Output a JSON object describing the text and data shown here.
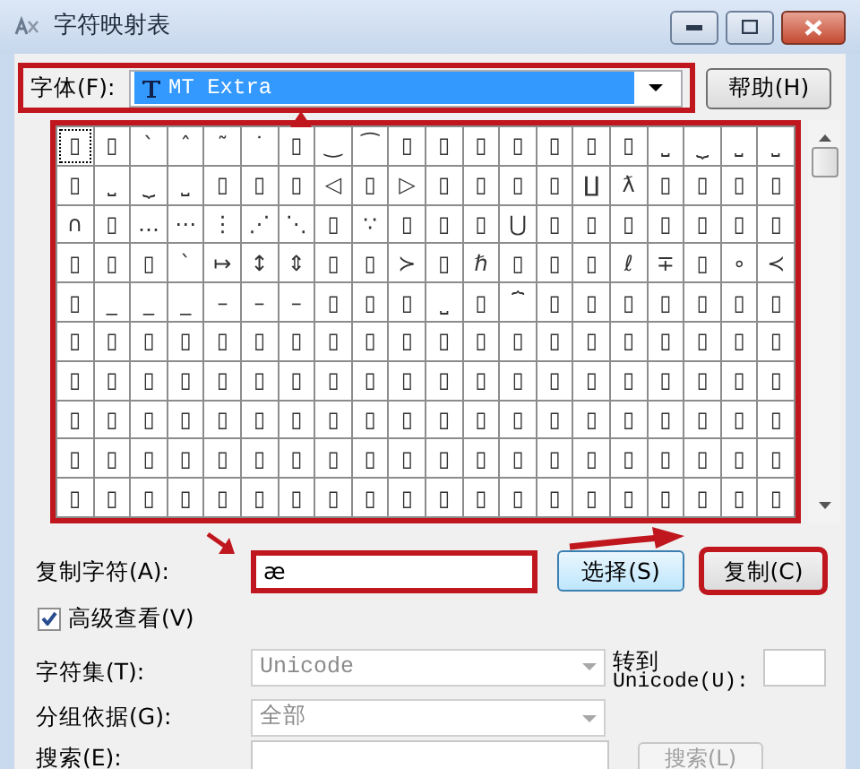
{
  "window": {
    "title": "字符映射表"
  },
  "font": {
    "label": "字体(F):",
    "value": "MT Extra",
    "highlighted": true
  },
  "help_button": {
    "label": "帮助(H)"
  },
  "character_grid": {
    "highlighted": true,
    "rows": [
      [
        {
          "char": "▯",
          "selected": true
        },
        {
          "char": "▯",
          "selected": false
        },
        {
          "char": "`",
          "selected": false
        },
        {
          "char": "ˆ",
          "selected": false
        },
        {
          "char": "˜",
          "selected": false
        },
        {
          "char": "˙",
          "selected": false
        },
        {
          "char": "▯",
          "selected": false
        },
        {
          "char": "‿",
          "selected": false
        },
        {
          "char": "⁀",
          "selected": false
        },
        {
          "char": "▯",
          "selected": false
        },
        {
          "char": "▯",
          "selected": false
        },
        {
          "char": "▯",
          "selected": false
        },
        {
          "char": "▯",
          "selected": false
        },
        {
          "char": "▯",
          "selected": false
        },
        {
          "char": "▯",
          "selected": false
        },
        {
          "char": "▯",
          "selected": false
        },
        {
          "char": "⎵",
          "selected": false
        },
        {
          "char": "⏟",
          "selected": false
        },
        {
          "char": "⎵",
          "selected": false
        },
        {
          "char": "⎵",
          "selected": false
        }
      ],
      [
        {
          "char": "▯",
          "selected": false
        },
        {
          "char": "⎵",
          "selected": false
        },
        {
          "char": "⏟",
          "selected": false
        },
        {
          "char": "⎵",
          "selected": false
        },
        {
          "char": "▯",
          "selected": false
        },
        {
          "char": "▯",
          "selected": false
        },
        {
          "char": "▯",
          "selected": false
        },
        {
          "char": "◁",
          "selected": false
        },
        {
          "char": "▯",
          "selected": false
        },
        {
          "char": "▷",
          "selected": false
        },
        {
          "char": "▯",
          "selected": false
        },
        {
          "char": "▯",
          "selected": false
        },
        {
          "char": "▯",
          "selected": false
        },
        {
          "char": "▯",
          "selected": false
        },
        {
          "char": "∐",
          "selected": false
        },
        {
          "char": "ƛ",
          "selected": false
        },
        {
          "char": "▯",
          "selected": false
        },
        {
          "char": "▯",
          "selected": false
        },
        {
          "char": "▯",
          "selected": false
        },
        {
          "char": "▯",
          "selected": false
        }
      ],
      [
        {
          "char": "∩",
          "selected": false
        },
        {
          "char": "▯",
          "selected": false
        },
        {
          "char": "…",
          "selected": false
        },
        {
          "char": "⋯",
          "selected": false
        },
        {
          "char": "⋮",
          "selected": false
        },
        {
          "char": "⋰",
          "selected": false
        },
        {
          "char": "⋱",
          "selected": false
        },
        {
          "char": "▯",
          "selected": false
        },
        {
          "char": "∵",
          "selected": false
        },
        {
          "char": "▯",
          "selected": false
        },
        {
          "char": "▯",
          "selected": false
        },
        {
          "char": "▯",
          "selected": false
        },
        {
          "char": "⋃",
          "selected": false
        },
        {
          "char": "▯",
          "selected": false
        },
        {
          "char": "▯",
          "selected": false
        },
        {
          "char": "▯",
          "selected": false
        },
        {
          "char": "▯",
          "selected": false
        },
        {
          "char": "▯",
          "selected": false
        },
        {
          "char": "▯",
          "selected": false
        },
        {
          "char": "▯",
          "selected": false
        }
      ],
      [
        {
          "char": "▯",
          "selected": false
        },
        {
          "char": "▯",
          "selected": false
        },
        {
          "char": "▯",
          "selected": false
        },
        {
          "char": "ˋ",
          "selected": false
        },
        {
          "char": "↦",
          "selected": false
        },
        {
          "char": "↕",
          "selected": false
        },
        {
          "char": "⇕",
          "selected": false
        },
        {
          "char": "▯",
          "selected": false
        },
        {
          "char": "▯",
          "selected": false
        },
        {
          "char": "≻",
          "selected": false
        },
        {
          "char": "▯",
          "selected": false
        },
        {
          "char": "ℏ",
          "selected": false
        },
        {
          "char": "▯",
          "selected": false
        },
        {
          "char": "▯",
          "selected": false
        },
        {
          "char": "▯",
          "selected": false
        },
        {
          "char": "ℓ",
          "selected": false
        },
        {
          "char": "∓",
          "selected": false
        },
        {
          "char": "▯",
          "selected": false
        },
        {
          "char": "∘",
          "selected": false
        },
        {
          "char": "≺",
          "selected": false
        }
      ],
      [
        {
          "char": "▯",
          "selected": false
        },
        {
          "char": "_",
          "selected": false
        },
        {
          "char": "_",
          "selected": false
        },
        {
          "char": "_",
          "selected": false
        },
        {
          "char": "–",
          "selected": false
        },
        {
          "char": "–",
          "selected": false
        },
        {
          "char": "–",
          "selected": false
        },
        {
          "char": "▯",
          "selected": false
        },
        {
          "char": "▯",
          "selected": false
        },
        {
          "char": "▯",
          "selected": false
        },
        {
          "char": "⎵",
          "selected": false
        },
        {
          "char": "▯",
          "selected": false
        },
        {
          "char": "⏞",
          "selected": false
        },
        {
          "char": "▯",
          "selected": false
        },
        {
          "char": "▯",
          "selected": false
        },
        {
          "char": "▯",
          "selected": false
        },
        {
          "char": "▯",
          "selected": false
        },
        {
          "char": "▯",
          "selected": false
        },
        {
          "char": "▯",
          "selected": false
        },
        {
          "char": "▯",
          "selected": false
        }
      ],
      [
        {
          "char": "▯",
          "selected": false
        },
        {
          "char": "▯",
          "selected": false
        },
        {
          "char": "▯",
          "selected": false
        },
        {
          "char": "▯",
          "selected": false
        },
        {
          "char": "▯",
          "selected": false
        },
        {
          "char": "▯",
          "selected": false
        },
        {
          "char": "▯",
          "selected": false
        },
        {
          "char": "▯",
          "selected": false
        },
        {
          "char": "▯",
          "selected": false
        },
        {
          "char": "▯",
          "selected": false
        },
        {
          "char": "▯",
          "selected": false
        },
        {
          "char": "▯",
          "selected": false
        },
        {
          "char": "▯",
          "selected": false
        },
        {
          "char": "▯",
          "selected": false
        },
        {
          "char": "▯",
          "selected": false
        },
        {
          "char": "▯",
          "selected": false
        },
        {
          "char": "▯",
          "selected": false
        },
        {
          "char": "▯",
          "selected": false
        },
        {
          "char": "▯",
          "selected": false
        },
        {
          "char": "▯",
          "selected": false
        }
      ],
      [
        {
          "char": "▯",
          "selected": false
        },
        {
          "char": "▯",
          "selected": false
        },
        {
          "char": "▯",
          "selected": false
        },
        {
          "char": "▯",
          "selected": false
        },
        {
          "char": "▯",
          "selected": false
        },
        {
          "char": "▯",
          "selected": false
        },
        {
          "char": "▯",
          "selected": false
        },
        {
          "char": "▯",
          "selected": false
        },
        {
          "char": "▯",
          "selected": false
        },
        {
          "char": "▯",
          "selected": false
        },
        {
          "char": "▯",
          "selected": false
        },
        {
          "char": "▯",
          "selected": false
        },
        {
          "char": "▯",
          "selected": false
        },
        {
          "char": "▯",
          "selected": false
        },
        {
          "char": "▯",
          "selected": false
        },
        {
          "char": "▯",
          "selected": false
        },
        {
          "char": "▯",
          "selected": false
        },
        {
          "char": "▯",
          "selected": false
        },
        {
          "char": "▯",
          "selected": false
        },
        {
          "char": "▯",
          "selected": false
        }
      ],
      [
        {
          "char": "▯",
          "selected": false
        },
        {
          "char": "▯",
          "selected": false
        },
        {
          "char": "▯",
          "selected": false
        },
        {
          "char": "▯",
          "selected": false
        },
        {
          "char": "▯",
          "selected": false
        },
        {
          "char": "▯",
          "selected": false
        },
        {
          "char": "▯",
          "selected": false
        },
        {
          "char": "▯",
          "selected": false
        },
        {
          "char": "▯",
          "selected": false
        },
        {
          "char": "▯",
          "selected": false
        },
        {
          "char": "▯",
          "selected": false
        },
        {
          "char": "▯",
          "selected": false
        },
        {
          "char": "▯",
          "selected": false
        },
        {
          "char": "▯",
          "selected": false
        },
        {
          "char": "▯",
          "selected": false
        },
        {
          "char": "▯",
          "selected": false
        },
        {
          "char": "▯",
          "selected": false
        },
        {
          "char": "▯",
          "selected": false
        },
        {
          "char": "▯",
          "selected": false
        },
        {
          "char": "▯",
          "selected": false
        }
      ],
      [
        {
          "char": "▯",
          "selected": false
        },
        {
          "char": "▯",
          "selected": false
        },
        {
          "char": "▯",
          "selected": false
        },
        {
          "char": "▯",
          "selected": false
        },
        {
          "char": "▯",
          "selected": false
        },
        {
          "char": "▯",
          "selected": false
        },
        {
          "char": "▯",
          "selected": false
        },
        {
          "char": "▯",
          "selected": false
        },
        {
          "char": "▯",
          "selected": false
        },
        {
          "char": "▯",
          "selected": false
        },
        {
          "char": "▯",
          "selected": false
        },
        {
          "char": "▯",
          "selected": false
        },
        {
          "char": "▯",
          "selected": false
        },
        {
          "char": "▯",
          "selected": false
        },
        {
          "char": "▯",
          "selected": false
        },
        {
          "char": "▯",
          "selected": false
        },
        {
          "char": "▯",
          "selected": false
        },
        {
          "char": "▯",
          "selected": false
        },
        {
          "char": "▯",
          "selected": false
        },
        {
          "char": "▯",
          "selected": false
        }
      ],
      [
        {
          "char": "▯",
          "selected": false
        },
        {
          "char": "▯",
          "selected": false
        },
        {
          "char": "▯",
          "selected": false
        },
        {
          "char": "▯",
          "selected": false
        },
        {
          "char": "▯",
          "selected": false
        },
        {
          "char": "▯",
          "selected": false
        },
        {
          "char": "▯",
          "selected": false
        },
        {
          "char": "▯",
          "selected": false
        },
        {
          "char": "▯",
          "selected": false
        },
        {
          "char": "▯",
          "selected": false
        },
        {
          "char": "▯",
          "selected": false
        },
        {
          "char": "▯",
          "selected": false
        },
        {
          "char": "▯",
          "selected": false
        },
        {
          "char": "▯",
          "selected": false
        },
        {
          "char": "▯",
          "selected": false
        },
        {
          "char": "▯",
          "selected": false
        },
        {
          "char": "▯",
          "selected": false
        },
        {
          "char": "▯",
          "selected": false
        },
        {
          "char": "▯",
          "selected": false
        },
        {
          "char": "▯",
          "selected": false
        }
      ]
    ]
  },
  "copy": {
    "label": "复制字符(A):",
    "value": "æ",
    "highlighted": true
  },
  "select_button": {
    "label": "选择(S)",
    "highlighted": false
  },
  "copy_button": {
    "label": "复制(C)",
    "highlighted": true
  },
  "advanced_view": {
    "label": "高级查看(V)",
    "checked": true
  },
  "character_set": {
    "label": "字符集(T):",
    "value": "Unicode",
    "disabled": true
  },
  "goto_unicode": {
    "label": [
      "转到",
      "Unicode(U):"
    ]
  },
  "group_by": {
    "label": "分组依据(G):",
    "value": "全部",
    "disabled": true
  },
  "search": {
    "label": "搜索(E):",
    "button": "搜索(L)",
    "button_disabled": true
  }
}
